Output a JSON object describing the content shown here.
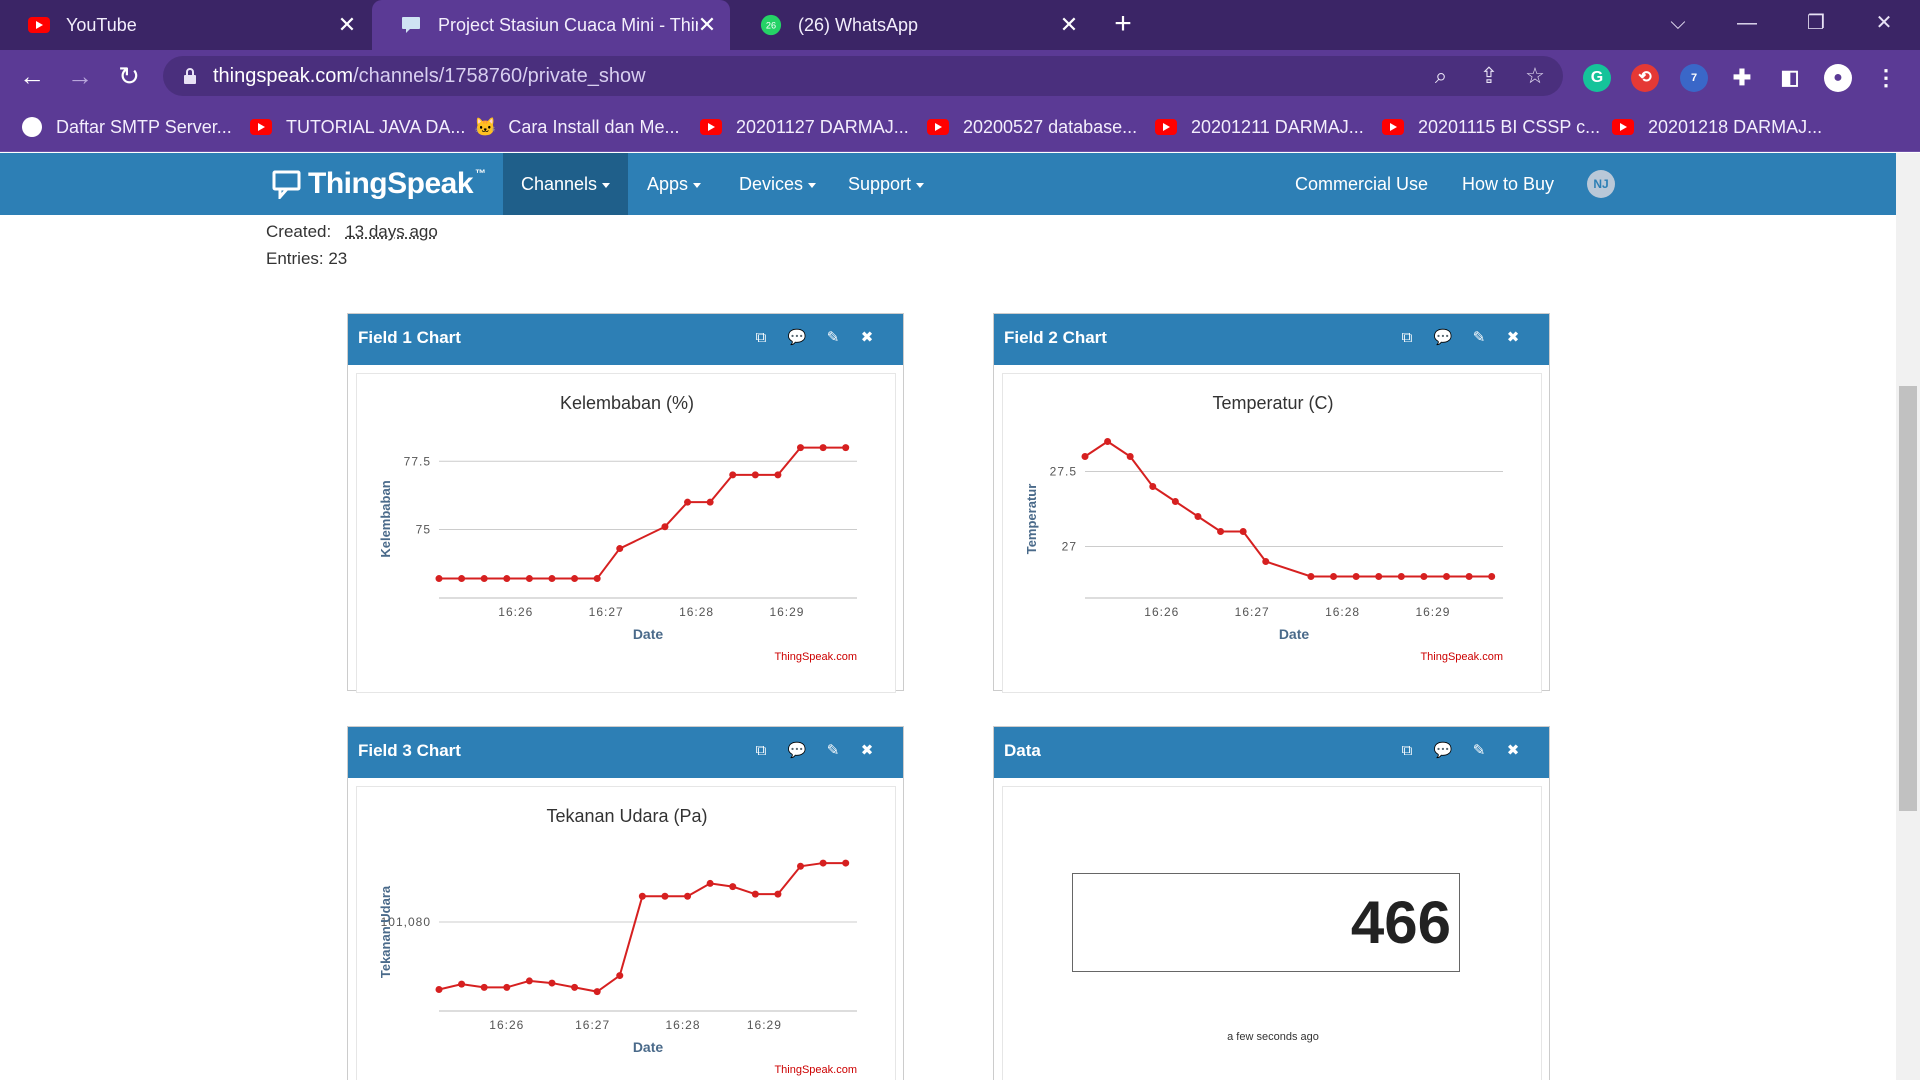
{
  "browser": {
    "tabs": [
      {
        "title": "YouTube",
        "icon": "youtube-icon"
      },
      {
        "title": "Project Stasiun Cuaca Mini - Thin",
        "icon": "thingspeak-icon"
      },
      {
        "title": "(26) WhatsApp",
        "icon": "whatsapp-icon",
        "badge": "26"
      }
    ],
    "url_host": "thingspeak.com",
    "url_path": "/channels/1758760/private_show",
    "extension_badge": "7",
    "bookmarks": [
      {
        "label": "Daftar SMTP Server...",
        "icon": "globe-icon"
      },
      {
        "label": "TUTORIAL JAVA DA...",
        "icon": "youtube-icon"
      },
      {
        "label": "Cara Install dan Me...",
        "icon": "cat-icon"
      },
      {
        "label": "20201127 DARMAJ...",
        "icon": "youtube-icon"
      },
      {
        "label": "20200527 database...",
        "icon": "youtube-icon"
      },
      {
        "label": "20201211 DARMAJ...",
        "icon": "youtube-icon"
      },
      {
        "label": "20201115 BI CSSP c...",
        "icon": "youtube-icon"
      },
      {
        "label": "20201218 DARMAJ...",
        "icon": "youtube-icon"
      }
    ]
  },
  "site": {
    "brand": "ThingSpeak",
    "tm": "™",
    "nav": [
      "Channels",
      "Apps",
      "Devices",
      "Support"
    ],
    "right_nav": [
      "Commercial Use",
      "How to Buy"
    ],
    "avatar": "NJ"
  },
  "channel": {
    "created_label": "Created:",
    "created_value": "13 days ago",
    "entries_label": "Entries: 23"
  },
  "colors": {
    "header": "#2d7fb5",
    "line": "#d62020",
    "chrome": "#5b3a95"
  },
  "panels": [
    {
      "header": "Field 1 Chart"
    },
    {
      "header": "Field 2 Chart"
    },
    {
      "header": "Field 3 Chart"
    },
    {
      "header": "Data"
    }
  ],
  "chart_data": [
    {
      "type": "line",
      "title": "Kelembaban (%)",
      "xlabel": "Date",
      "ylabel": "Kelembaban",
      "credit": "ThingSpeak.com",
      "xticks": [
        "16:26",
        "16:27",
        "16:28",
        "16:29"
      ],
      "yticks": [
        {
          "label": "75",
          "value": 75
        },
        {
          "label": "77.5",
          "value": 77.5
        }
      ],
      "ylim": [
        73,
        78.5
      ],
      "xlim": [
        0,
        18.5
      ],
      "x": [
        0,
        1,
        2,
        3,
        4,
        5,
        6,
        7,
        8,
        10,
        11,
        12,
        13,
        14,
        15,
        16,
        17,
        18
      ],
      "values": [
        73.2,
        73.2,
        73.2,
        73.2,
        73.2,
        73.2,
        73.2,
        73.2,
        74.3,
        75.1,
        76.0,
        76.0,
        77.0,
        77.0,
        77.0,
        78.0,
        78.0,
        78.0
      ],
      "xtick_pos": [
        3.4,
        7.4,
        11.4,
        15.4
      ]
    },
    {
      "type": "line",
      "title": "Temperatur (C)",
      "xlabel": "Date",
      "ylabel": "Temperatur",
      "credit": "ThingSpeak.com",
      "xticks": [
        "16:26",
        "16:27",
        "16:28",
        "16:29"
      ],
      "yticks": [
        {
          "label": "27",
          "value": 27
        },
        {
          "label": "27.5",
          "value": 27.5
        }
      ],
      "ylim": [
        26.75,
        27.75
      ],
      "xlim": [
        0,
        18.5
      ],
      "x": [
        0,
        1,
        2,
        3,
        4,
        5,
        6,
        7,
        8,
        10,
        11,
        12,
        13,
        14,
        15,
        16,
        17,
        18
      ],
      "values": [
        27.6,
        27.7,
        27.6,
        27.4,
        27.3,
        27.2,
        27.1,
        27.1,
        26.9,
        26.8,
        26.8,
        26.8,
        26.8,
        26.8,
        26.8,
        26.8,
        26.8,
        26.8
      ],
      "xtick_pos": [
        3.4,
        7.4,
        11.4,
        15.4
      ]
    },
    {
      "type": "line",
      "title": "Tekanan Udara (Pa)",
      "xlabel": "Date",
      "ylabel": "Tekanan Udara",
      "credit": "ThingSpeak.com",
      "xticks": [
        "16:26",
        "16:27",
        "16:28",
        "16:29"
      ],
      "yticks": [
        {
          "label": "101,080",
          "value": 101080
        }
      ],
      "ylim": [
        101073,
        101087
      ],
      "xlim": [
        0,
        18.5
      ],
      "x": [
        0,
        1,
        2,
        3,
        4,
        5,
        6,
        7,
        8,
        9,
        10,
        11,
        12,
        13,
        14,
        15,
        16,
        17,
        18
      ],
      "values": [
        101073.7,
        101074.2,
        101073.9,
        101073.9,
        101074.5,
        101074.3,
        101073.9,
        101073.5,
        101075.0,
        101082.4,
        101082.4,
        101082.4,
        101083.6,
        101083.3,
        101082.6,
        101082.6,
        101085.2,
        101085.5,
        101085.5
      ],
      "xtick_pos": [
        3.0,
        6.8,
        10.8,
        14.4
      ]
    }
  ],
  "lamp": {
    "value": "466",
    "timestamp": "a few seconds ago"
  }
}
